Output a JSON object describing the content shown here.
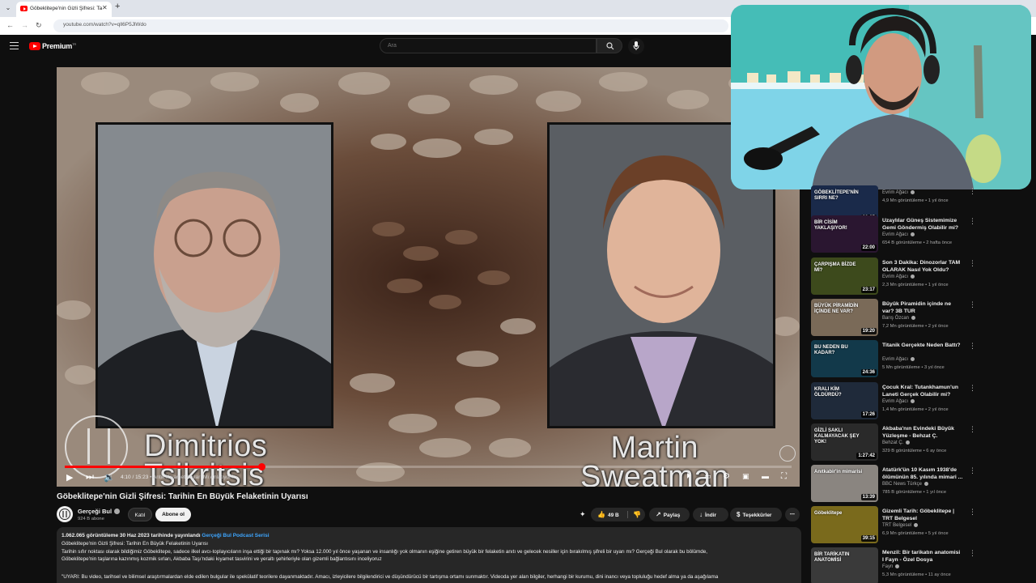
{
  "browser": {
    "tab_title": "Göbeklitepe'nin Gizli Şifresi: Ta",
    "url": "youtube.com/watch?v=qll6P5JlWdo"
  },
  "header": {
    "brand": "Premium",
    "brand_sup": "TR",
    "search_placeholder": "Ara"
  },
  "player": {
    "left_name": [
      "Dimitrios",
      "Tsikritsis"
    ],
    "right_name": [
      "Martin",
      "Sweatman"
    ],
    "time": "4:10 / 15:23",
    "chapter": "• Antik Kıyamet Anıları Mı Anlatıyor? ›",
    "progress": 0.271
  },
  "video": {
    "title": "Göbeklitepe'nin Gizli Şifresi: Tarihin En Büyük Felaketinin Uyarısı",
    "channel": "Gerçeği Bul",
    "subscribers": "924 B abone",
    "join_label": "Katıl",
    "subscribe_label": "Abone ol",
    "likes": "49 B",
    "share_label": "Paylaş",
    "download_label": "İndir",
    "thanks_label": "Teşekkürler"
  },
  "description": {
    "stats": "1.062.065 görüntüleme  30 Haz 2023 tarihinde yayınlandı",
    "hashtag": "Gerçeği Bul Podcast Serisi",
    "lines": [
      "Göbeklitepe'nin Gizli Şifresi: Tarihin En Büyük Felaketinin Uyarısı",
      "Tarihin sıfır noktası olarak bildiğimiz Göbeklitepe, sadece ilkel avcı-toplayıcıların inşa ettiği bir tapınak mı? Yoksa 12.000 yıl önce yaşanan ve insanlığı yok olmanın eşiğine getiren büyük bir felaketin anıtı ve gelecek nesiller için bırakılmış şifreli bir uyarı mı? Gerçeği Bul olarak bu bölümde,",
      "Göbeklitepe'nin taşlarına kazınmış kozmik sırları, Akbaba Taşı'ndaki kıyamet tasvirini ve yeraltı şehirleriyle olan gizemli bağlantısını inceliyoruz",
      "\"UYARI: Bu video, tarihsel ve bilimsel araştırmalardan elde edilen bulgular ile spekülatif teorilere dayanmaktadır. Amacı, izleyicilere bilgilendirici ve düşündürücü bir tartışma ortamı sunmaktır. Videoda yer alan bilgiler, herhangi bir kurumu, dini inancı veya topluluğu hedef alma ya da aşağılama"
    ]
  },
  "recommendations": [
    {
      "title": "",
      "channel": "Evrim Ağacı",
      "meta": "4,9 Mn görüntüleme • 1 yıl önce",
      "duration": "30:35",
      "thumb_text": "GÖBEKLİTEPE'NİN SIRRI NE?",
      "thumb_bg": "#1a2a4a"
    },
    {
      "title": "Uzaylılar Güneş Sistemimize Gemi Göndermiş Olabilir mi?",
      "channel": "Evrim Ağacı",
      "meta": "654 B görüntüleme • 2 hafta önce",
      "duration": "22:00",
      "thumb_text": "BİR CİSİM YAKLAŞIYOR!",
      "thumb_bg": "#2a1630"
    },
    {
      "title": "Son 3 Dakika: Dinozorlar TAM OLARAK Nasıl Yok Oldu?",
      "channel": "Evrim Ağacı",
      "meta": "2,3 Mn görüntüleme • 1 yıl önce",
      "duration": "23:17",
      "thumb_text": "ÇARPIŞMA BİZDE Mİ?",
      "thumb_bg": "#3d4a1c"
    },
    {
      "title": "Büyük Piramidin içinde ne var? 3B TUR",
      "channel": "Barış Özcan",
      "meta": "7,2 Mn görüntüleme • 2 yıl önce",
      "duration": "19:20",
      "thumb_text": "BÜYÜK PİRAMİDİN İÇİNDE NE VAR?",
      "thumb_bg": "#7a6a58"
    },
    {
      "title": "Titanik Gerçekte Neden Battı?",
      "channel": "Evrim Ağacı",
      "meta": "5 Mn görüntüleme • 3 yıl önce",
      "duration": "24:36",
      "thumb_text": "BU NEDEN BU KADAR?",
      "thumb_bg": "#12394a"
    },
    {
      "title": "Çocuk Kral: Tutankhamun'un Laneti Gerçek Olabilir mi?",
      "channel": "Evrim Ağacı",
      "meta": "1,4 Mn görüntüleme • 2 yıl önce",
      "duration": "17:26",
      "thumb_text": "KRALI KİM ÖLDÜRDÜ?",
      "thumb_bg": "#1f2a3a"
    },
    {
      "title": "Akbaba'nın Evindeki Büyük Yüzleşme - Behzat Ç.",
      "channel": "Behzat Ç.",
      "meta": "329 B görüntüleme • 6 ay önce",
      "duration": "1:27:42",
      "thumb_text": "GİZLİ SAKLI KALMAYACAK ŞEY YOK!",
      "thumb_bg": "#2a2a2a"
    },
    {
      "title": "Atatürk'ün 10 Kasım 1938'de ölümünün 85. yılında mimari ...",
      "channel": "BBC News Türkçe",
      "meta": "785 B görüntüleme • 1 yıl önce",
      "duration": "13:39",
      "thumb_text": "Anıtkabir'in mimarisi",
      "thumb_bg": "#8a8580"
    },
    {
      "title": "Gizemli Tarih: Göbeklitepe | TRT Belgesel",
      "channel": "TRT Belgesel",
      "meta": "6,9 Mn görüntüleme • 5 yıl önce",
      "duration": "39:15",
      "thumb_text": "Göbeklitepe",
      "thumb_bg": "#7a6a1c"
    },
    {
      "title": "Menzil: Bir tarikatın anatomisi I Fayn - Özel Dosya",
      "channel": "Fayn",
      "meta": "5,3 Mn görüntüleme • 11 ay önce",
      "duration": "",
      "thumb_text": "BİR TARİKATIN ANATOMİSİ",
      "thumb_bg": "#3a3a3a"
    }
  ],
  "colors": {
    "accent": "#ff0000",
    "link": "#3ea6ff"
  }
}
